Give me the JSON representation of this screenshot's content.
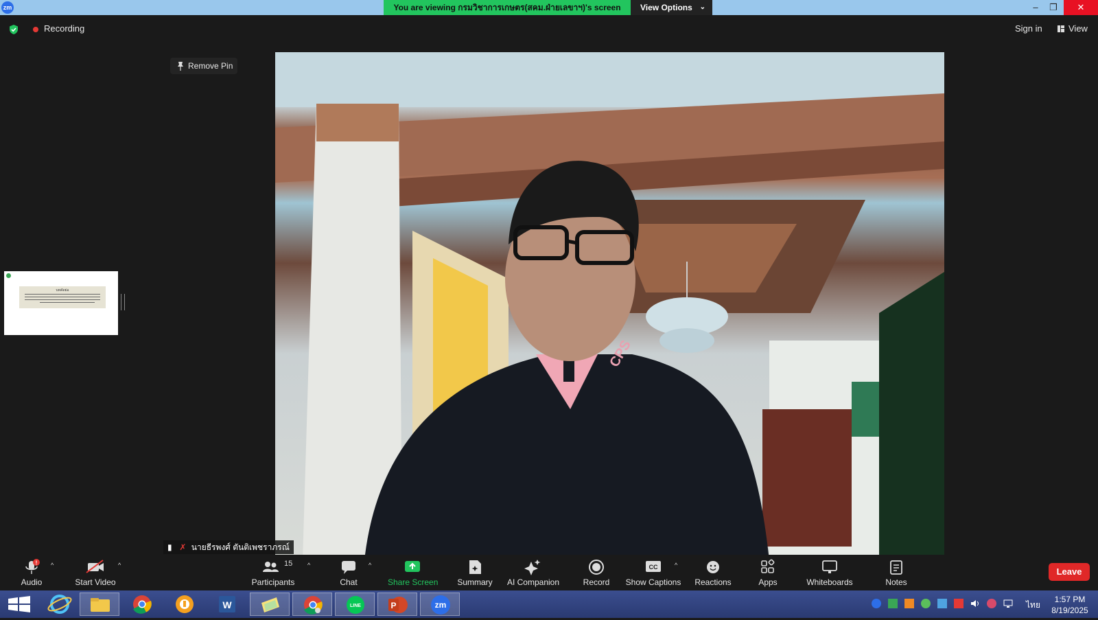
{
  "titlebar": {
    "logo": "zm",
    "banner_text": "You are viewing กรมวิชาการเกษตร(สคม.ฝ่ายเลขาฯ)'s screen",
    "view_options_label": "View Options",
    "minimize_glyph": "–",
    "restore_glyph": "❐",
    "close_glyph": "✕"
  },
  "header": {
    "recording_label": "Recording",
    "sign_in_label": "Sign in",
    "view_label": "View"
  },
  "pin": {
    "remove_pin_label": "Remove Pin"
  },
  "video": {
    "participant_name": "นายธีรพงศ์ ตันติเพชราภรณ์",
    "shirt_logo": "CPS"
  },
  "thumbnail": {
    "doc_title": "บทคัดย่อ"
  },
  "toolbar": {
    "audio": "Audio",
    "audio_badge": "!",
    "start_video": "Start Video",
    "participants": "Participants",
    "participants_count": "15",
    "chat": "Chat",
    "share_screen": "Share Screen",
    "summary": "Summary",
    "ai_companion": "AI Companion",
    "record": "Record",
    "show_captions": "Show Captions",
    "captions_icon_text": "CC",
    "reactions": "Reactions",
    "apps": "Apps",
    "whiteboards": "Whiteboards",
    "notes": "Notes",
    "leave": "Leave"
  },
  "taskbar": {
    "apps": [
      "start-button",
      "internet-explorer",
      "file-explorer",
      "chrome",
      "vpn-app",
      "word",
      "sticky-notes",
      "chrome-profile",
      "line",
      "powerpoint",
      "zoom"
    ],
    "word_letter": "W",
    "powerpoint_letter": "P",
    "zoom_letter": "zm",
    "line_text": "LINE",
    "language": "ไทย",
    "time": "1:57 PM",
    "date": "8/19/2025"
  },
  "colors": {
    "zoom_blue": "#2d6ee8",
    "banner_green": "#22c55e",
    "recording_red": "#e53935",
    "leave_red": "#e02828"
  }
}
